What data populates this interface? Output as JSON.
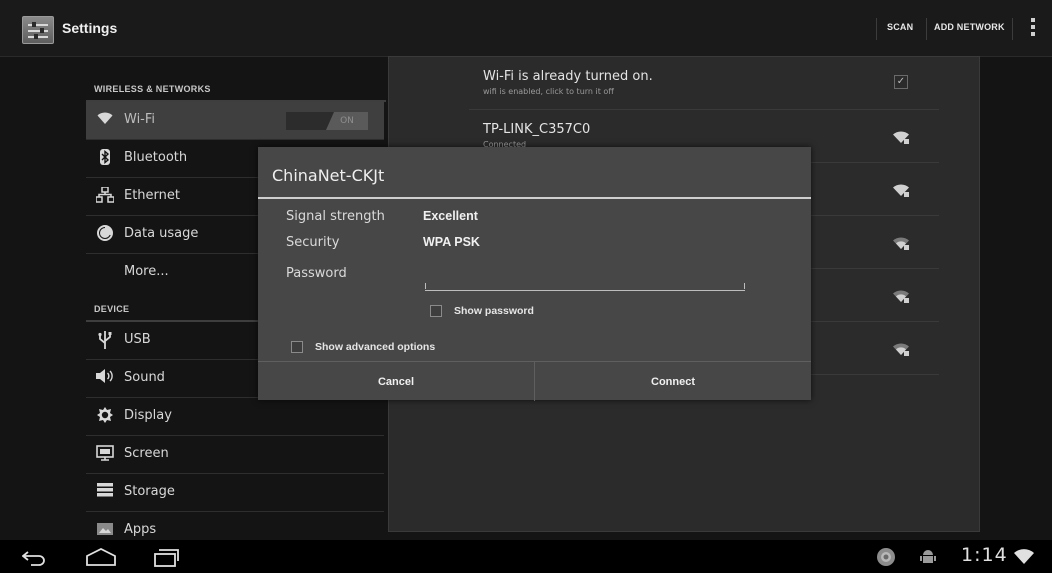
{
  "action_bar": {
    "title": "Settings",
    "actions": [
      "SCAN",
      "ADD NETWORK"
    ],
    "app_icon": "settings-icon",
    "overflow_icon": "overflow-menu-icon"
  },
  "sidebar": {
    "sections": [
      {
        "header": "WIRELESS & NETWORKS",
        "items": [
          {
            "label": "Wi-Fi",
            "icon": "wifi-icon",
            "toggle": "ON",
            "selected": true
          },
          {
            "label": "Bluetooth",
            "icon": "bluetooth-icon"
          },
          {
            "label": "Ethernet",
            "icon": "ethernet-icon"
          },
          {
            "label": "Data usage",
            "icon": "data-usage-icon"
          },
          {
            "label": "More...",
            "icon": ""
          }
        ]
      },
      {
        "header": "DEVICE",
        "items": [
          {
            "label": "USB",
            "icon": "usb-icon"
          },
          {
            "label": "Sound",
            "icon": "sound-icon"
          },
          {
            "label": "Display",
            "icon": "display-icon"
          },
          {
            "label": "Screen",
            "icon": "screen-icon"
          },
          {
            "label": "Storage",
            "icon": "storage-icon"
          },
          {
            "label": "Apps",
            "icon": "apps-icon"
          }
        ]
      }
    ]
  },
  "wifi_list": {
    "status": {
      "title": "Wi-Fi is already turned on.",
      "subtitle": "wifi is enabled, click to turn it off",
      "checked": true
    },
    "networks": [
      {
        "ssid": "TP-LINK_C357C0",
        "status": "Connected",
        "signal": "strong"
      },
      {
        "ssid": "",
        "status": "",
        "signal": "strong"
      },
      {
        "ssid": "",
        "status": "",
        "signal": "medium"
      },
      {
        "ssid": "",
        "status": "",
        "signal": "medium"
      },
      {
        "ssid": "",
        "status": "",
        "signal": "medium"
      }
    ]
  },
  "dialog": {
    "title": "ChinaNet-CKJt",
    "signal_label": "Signal strength",
    "signal_value": "Excellent",
    "security_label": "Security",
    "security_value": "WPA PSK",
    "password_label": "Password",
    "password_value": "",
    "show_password_label": "Show password",
    "show_password_checked": false,
    "advanced_label": "Show advanced options",
    "advanced_checked": false,
    "cancel_label": "Cancel",
    "connect_label": "Connect"
  },
  "nav_bar": {
    "clock": "1:14",
    "buttons": [
      "back-icon",
      "home-icon",
      "recent-apps-icon"
    ],
    "status_icons": [
      "notification-icon",
      "android-debug-icon",
      "wifi-signal-icon"
    ]
  }
}
